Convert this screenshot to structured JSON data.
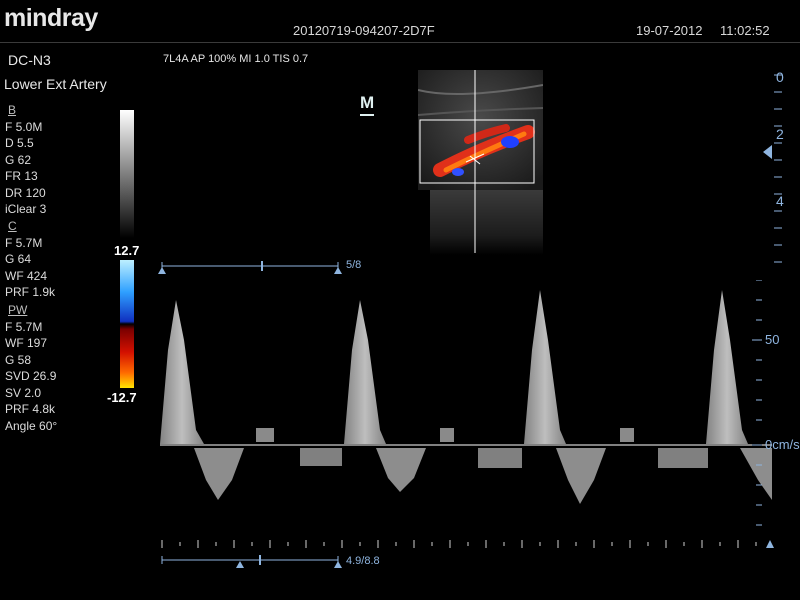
{
  "header": {
    "brand": "mindray",
    "study_id": "20120719-094207-2D7F",
    "date": "19-07-2012",
    "time": "11:02:52"
  },
  "probe": "DC-N3",
  "exam": "Lower Ext Artery",
  "acquisition": "7L4A  AP 100%  MI 1.0  TIS 0.7",
  "b_mode": {
    "title": "B",
    "params": [
      "F 5.0M",
      "D 5.5",
      "G 62",
      "FR 13",
      "DR 120",
      "iClear 3"
    ]
  },
  "color_mode": {
    "title": "C",
    "params": [
      "F 5.7M",
      "G 64",
      "WF 424",
      "PRF 1.9k"
    ]
  },
  "pw_mode": {
    "title": "PW",
    "params": [
      "F 5.7M",
      "WF 197",
      "G 58",
      "SVD 26.9",
      "SV 2.0",
      "PRF 4.8k",
      "Angle 60°"
    ]
  },
  "color_scale": {
    "max": "12.7",
    "min": "-12.7"
  },
  "mode_icon": "M",
  "depth_scale": [
    "0",
    "2",
    "4"
  ],
  "velocity_scale": {
    "value": "50",
    "baseline": "0cm/s"
  },
  "timeline_top": "5/8",
  "timeline_bottom": "4.9/8.8",
  "colors": {
    "accent": "#8fb5e0",
    "flow_red": "#e0301a",
    "flow_blue": "#2040ff"
  }
}
